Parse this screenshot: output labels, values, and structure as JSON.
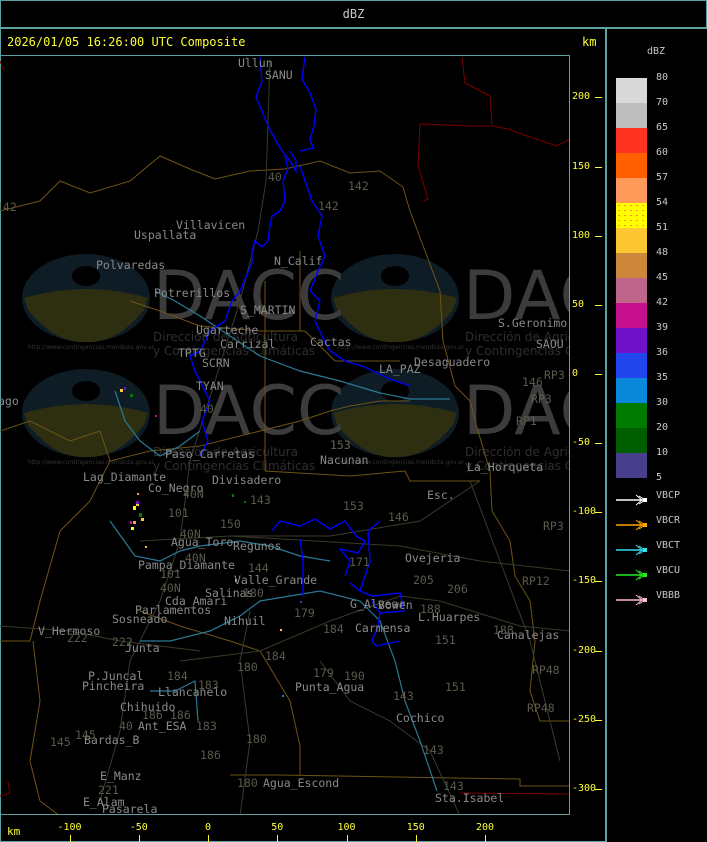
{
  "header": {
    "title": "dBZ"
  },
  "panel": {
    "timestamp_title": "2026/01/05 16:26:00 UTC Composite",
    "y_unit": "km",
    "x_unit": "km",
    "y_ticks": [
      200,
      150,
      100,
      50,
      0,
      -50,
      -100,
      -150,
      -200,
      -250,
      -300
    ],
    "x_ticks": [
      -100,
      -50,
      0,
      50,
      100,
      150,
      200
    ]
  },
  "watermark": {
    "brand": "DACC",
    "line1": "Dirección de Agricultura",
    "line2": "y Contingencias Climáticas",
    "url": "http://www.contingencias.mendoza.gov.ar"
  },
  "map": {
    "places": [
      "Ullun",
      "SANU",
      "Villavicen",
      "Uspallata",
      "Polvaredas",
      "N_Calif",
      "Potrerillos",
      "S_MARTIN",
      "Ugarteche",
      "Carrizal",
      "Cactas",
      "TPTG",
      "SCRN",
      "TYAN",
      "Paso_Carretas",
      "Divisadero",
      "Nacunan",
      "La_Horqueta",
      "Esc.",
      "S.Geronimo",
      "SAOU",
      "Desaguadero",
      "LA_PAZ",
      "Lag_Diamante",
      "Co_Negro",
      "Agua_Toro",
      "Pampa_Diamante",
      "Regunos",
      "Valle_Grande",
      "Salinas",
      "Cda_Amari",
      "Parlamentos",
      "Sosneado",
      "Nihuil",
      "V_Hermoso",
      "Junta",
      "P.Juncal",
      "Pincheira",
      "Llancanelo",
      "Chihuido",
      "Ant_ESA",
      "Bardas_B",
      "E_Manz",
      "E_Alam",
      "Pasarela",
      "Agua_Escond",
      "Punta_Agua",
      "G_Alvear",
      "Bowen",
      "Carmensa",
      "L.Huarpes",
      "Canalejas",
      "Ovejeria",
      "Cochico",
      "Sta.Isabel",
      "ago"
    ],
    "routes": [
      "40",
      "142",
      "142",
      "153",
      "153",
      "146",
      "146",
      "40N",
      "101",
      "143",
      "150",
      "40N",
      "40N",
      "101",
      "40N",
      "144",
      "180",
      "179",
      "184",
      "171",
      "205",
      "206",
      "188",
      "151",
      "151",
      "188",
      "184",
      "180",
      "184",
      "183",
      "179",
      "190",
      "143",
      "143",
      "143",
      "180",
      "180",
      "186",
      "186",
      "186",
      "183",
      "40",
      "145",
      "145",
      "221",
      "222",
      "222",
      "RP3",
      "RP12",
      "RP48",
      "RP48",
      "RP3",
      "RP3",
      "RP1",
      "40",
      "153",
      "142"
    ]
  },
  "legend": {
    "unit": "dBZ",
    "levels": [
      {
        "label": "80",
        "color": "#d9d9d9"
      },
      {
        "label": "70",
        "color": "#bebebe"
      },
      {
        "label": "65",
        "color": "#ff3322"
      },
      {
        "label": "60",
        "color": "#ff5f00"
      },
      {
        "label": "57",
        "color": "#ff9a5a"
      },
      {
        "label": "54",
        "color": "#ffff00"
      },
      {
        "label": "51",
        "color": "#fdc633"
      },
      {
        "label": "48",
        "color": "#cd873a"
      },
      {
        "label": "45",
        "color": "#bd668a"
      },
      {
        "label": "42",
        "color": "#c6108c"
      },
      {
        "label": "39",
        "color": "#7012c8"
      },
      {
        "label": "36",
        "color": "#2245ee"
      },
      {
        "label": "35",
        "color": "#0a88da"
      },
      {
        "label": "30",
        "color": "#007a00"
      },
      {
        "label": "20",
        "color": "#005e00"
      },
      {
        "label": "10",
        "color": "#473f8b"
      }
    ],
    "bottom_label": "5",
    "networks": [
      {
        "label": "VBCP",
        "color": "#ffffff"
      },
      {
        "label": "VBCR",
        "color": "#ffa500"
      },
      {
        "label": "VBCT",
        "color": "#33e0f0"
      },
      {
        "label": "VBCU",
        "color": "#22ee22"
      },
      {
        "label": "VBBB",
        "color": "#ffc0cb"
      }
    ]
  },
  "colors": {
    "frame": "#5fa0a0",
    "axis": "#ffff33",
    "storm_outline": "#0000ff",
    "province_border": "#7a5a1a",
    "country_border": "#7a0000",
    "river": "#2a7a95"
  }
}
